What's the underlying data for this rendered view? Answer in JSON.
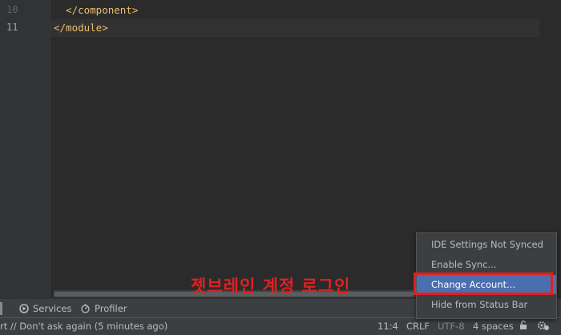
{
  "editor": {
    "lines": [
      {
        "number": "10",
        "code": "  </component>"
      },
      {
        "number": "11",
        "code": "</module>"
      }
    ]
  },
  "toolbar": {
    "services_label": "Services",
    "profiler_label": "Profiler"
  },
  "statusbar": {
    "message": "rt // Don't ask again (5 minutes ago)",
    "position": "11:4",
    "line_separator": "CRLF",
    "encoding": "UTF-8",
    "indent": "4 spaces"
  },
  "popup": {
    "items": [
      {
        "label": "IDE Settings Not Synced"
      },
      {
        "label": "Enable Sync..."
      },
      {
        "label": "Change Account..."
      },
      {
        "label": "Hide from Status Bar"
      }
    ]
  },
  "annotation": {
    "text": "젯브레인 계정 로그인"
  },
  "colors": {
    "accent_selection": "#4b6eaf",
    "annotation_red": "#e02020",
    "tag_color": "#e8bf6a"
  }
}
